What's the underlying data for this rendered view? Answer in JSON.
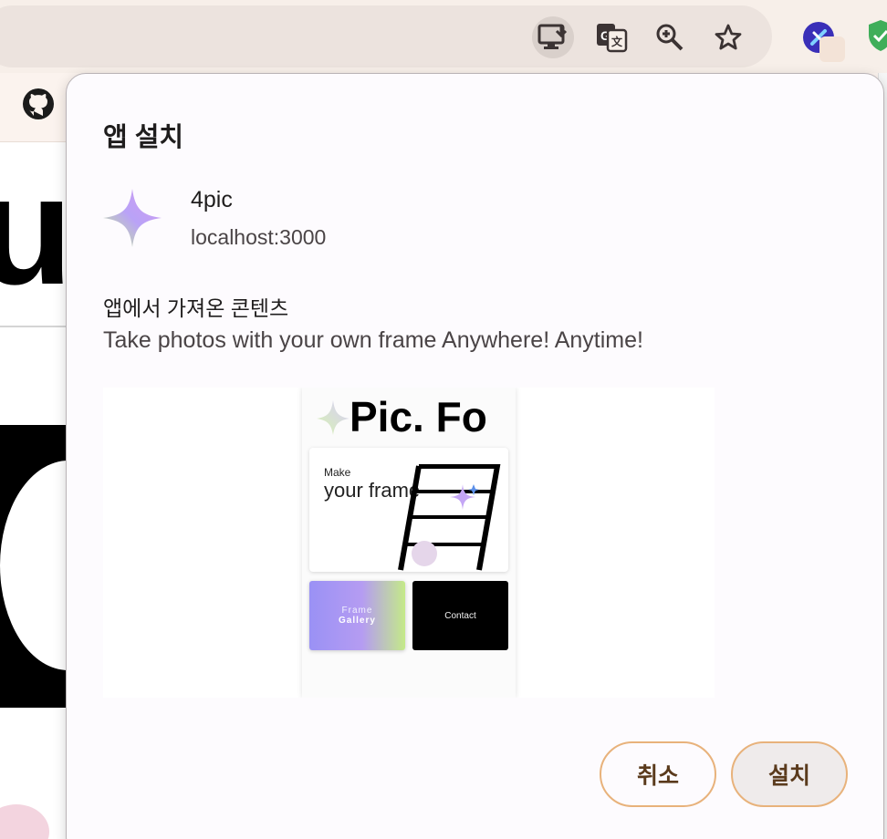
{
  "browser": {
    "toolbar_icons": [
      "install-app-icon",
      "translate-icon",
      "zoom-icon",
      "bookmark-star-icon"
    ],
    "extension_icons": [
      "extension-avatar-icon",
      "extension-shield-icon"
    ]
  },
  "background_page": {
    "logo_icon": "github-icon",
    "heading_fragment": "u"
  },
  "dialog": {
    "title": "앱 설치",
    "app": {
      "name": "4pic",
      "origin": "localhost:3000",
      "icon": "sparkle-star-icon"
    },
    "description_heading": "앱에서 가져온 콘텐츠",
    "description": "Take photos with your own frame Anywhere! Anytime!",
    "preview": {
      "logo_text": "Pic. Fo",
      "card_small": "Make",
      "card_large": "your frame",
      "tile_gallery_top": "Frame",
      "tile_gallery_bottom": "Gallery",
      "tile_contact": "Contact"
    },
    "buttons": {
      "cancel": "취소",
      "install": "설치"
    }
  },
  "colors": {
    "button_border": "#e8b27b",
    "dialog_bg": "#fdfbfe",
    "gradient_start": "#9a91f5",
    "gradient_end": "#c4ea88"
  }
}
